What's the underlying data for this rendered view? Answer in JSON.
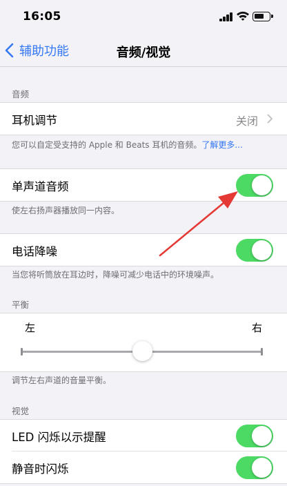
{
  "status_bar": {
    "time": "16:05",
    "battery_level": 0.55
  },
  "nav": {
    "back_label": "辅助功能",
    "title": "音频/视觉"
  },
  "audio_section": {
    "header": "音频",
    "headphone": {
      "label": "耳机调节",
      "value": "关闭"
    },
    "headphone_footer": "您可以自定受支持的 Apple 和 Beats 耳机的音频。",
    "learn_more": "了解更多...",
    "mono_audio": {
      "label": "单声道音频",
      "enabled": true
    },
    "mono_footer": "使左右扬声器播放同一内容。",
    "noise_cancel": {
      "label": "电话降噪",
      "enabled": true
    },
    "noise_footer": "当您将听筒放在耳边时，降噪可减少电话中的环境噪声。"
  },
  "balance_section": {
    "header": "平衡",
    "left_label": "左",
    "right_label": "右",
    "balance_value": 0.5,
    "footer": "调节左右声道的音量平衡。"
  },
  "visual_section": {
    "header": "视觉",
    "led_flash": {
      "label": "LED 闪烁以示提醒",
      "enabled": true
    },
    "silent_flash": {
      "label": "静音时闪烁",
      "enabled": true
    }
  },
  "colors": {
    "accent": "#3478f6",
    "switch_on": "#4cd964",
    "background": "#f2f2f7",
    "annotation": "#e53935"
  },
  "icons": [
    "back-chevron-icon",
    "disclosure-chevron-icon",
    "signal-icon",
    "wifi-icon",
    "battery-icon",
    "annotation-arrow-icon"
  ]
}
